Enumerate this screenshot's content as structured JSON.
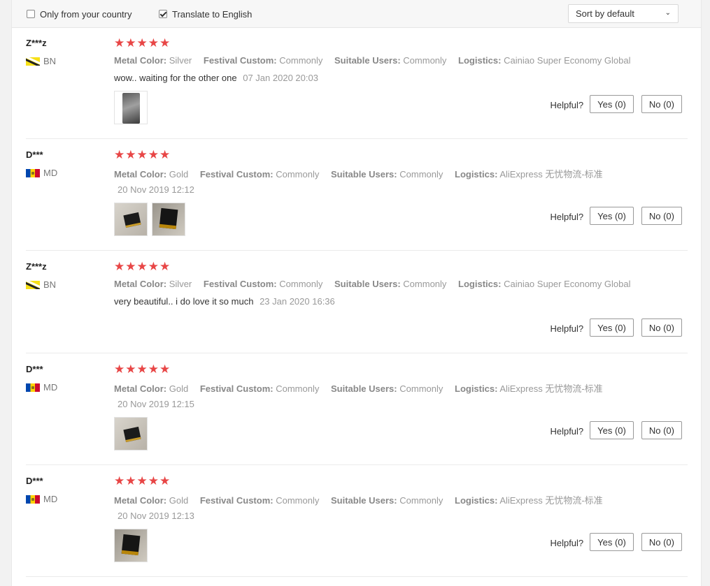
{
  "filters": {
    "only_country_label": "Only from your country",
    "only_country_checked": false,
    "translate_label": "Translate to English",
    "translate_checked": true,
    "sort_value": "Sort by default"
  },
  "labels": {
    "metal_color": "Metal Color:",
    "festival_custom": "Festival Custom:",
    "suitable_users": "Suitable Users:",
    "logistics": "Logistics:",
    "helpful": "Helpful?",
    "stars": "★★★★★"
  },
  "reviews": [
    {
      "user": "Z***z",
      "country": "BN",
      "rating": 5,
      "metal_color": "Silver",
      "festival_custom": "Commonly",
      "suitable_users": "Commonly",
      "logistics": "Cainiao Super Economy Global",
      "text": "wow.. waiting for the other one",
      "date": "07 Jan 2020 20:03",
      "photos": [
        "photo"
      ],
      "yes": "Yes (0)",
      "no": "No (0)"
    },
    {
      "user": "D***",
      "country": "MD",
      "rating": 5,
      "metal_color": "Gold",
      "festival_custom": "Commonly",
      "suitable_users": "Commonly",
      "logistics": "AliExpress 无忧物流-标准",
      "text": "",
      "date": "20 Nov 2019 12:12",
      "photos": [
        "photo",
        "photo"
      ],
      "yes": "Yes (0)",
      "no": "No (0)"
    },
    {
      "user": "Z***z",
      "country": "BN",
      "rating": 5,
      "metal_color": "Silver",
      "festival_custom": "Commonly",
      "suitable_users": "Commonly",
      "logistics": "Cainiao Super Economy Global",
      "text": "very beautiful.. i do love it so much",
      "date": "23 Jan 2020 16:36",
      "photos": [],
      "yes": "Yes (0)",
      "no": "No (0)"
    },
    {
      "user": "D***",
      "country": "MD",
      "rating": 5,
      "metal_color": "Gold",
      "festival_custom": "Commonly",
      "suitable_users": "Commonly",
      "logistics": "AliExpress 无忧物流-标准",
      "text": "",
      "date": "20 Nov 2019 12:15",
      "photos": [
        "photo"
      ],
      "yes": "Yes (0)",
      "no": "No (0)"
    },
    {
      "user": "D***",
      "country": "MD",
      "rating": 5,
      "metal_color": "Gold",
      "festival_custom": "Commonly",
      "suitable_users": "Commonly",
      "logistics": "AliExpress 无忧物流-标准",
      "text": "",
      "date": "20 Nov 2019 12:13",
      "photos": [
        "photo"
      ],
      "yes": "Yes (0)",
      "no": "No (0)"
    }
  ]
}
